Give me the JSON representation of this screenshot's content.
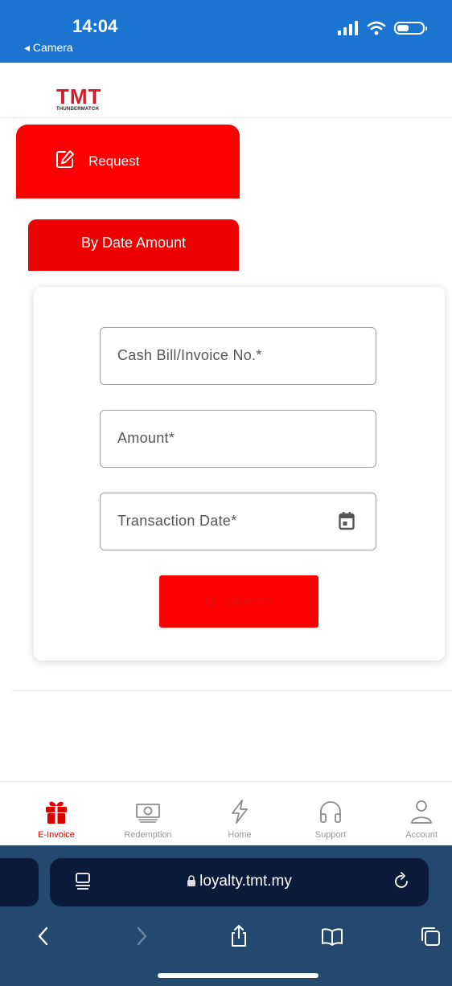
{
  "status_bar": {
    "time": "14:04",
    "back_label": "◂ Camera"
  },
  "header": {
    "logo_text": "TMT",
    "logo_subtext": "THUNDERMATCH"
  },
  "tabs": {
    "request_label": "Request",
    "mode_label": "By Date Amount"
  },
  "form": {
    "invoice_placeholder": "Cash Bill/Invoice No.*",
    "amount_placeholder": "Amount*",
    "date_placeholder": "Transaction Date*",
    "search_label": "Search"
  },
  "bottom_nav": {
    "items": [
      {
        "label": "E-Invoice",
        "icon": "gift-icon",
        "active": true
      },
      {
        "label": "Redemption",
        "icon": "banknote-icon",
        "active": false
      },
      {
        "label": "Home",
        "icon": "lightning-icon",
        "active": false
      },
      {
        "label": "Support",
        "icon": "headset-icon",
        "active": false
      },
      {
        "label": "Account",
        "icon": "user-icon",
        "active": false
      }
    ]
  },
  "browser": {
    "url": "loyalty.tmt.my"
  },
  "colors": {
    "status_bar": "#1b74d0",
    "accent_red": "#ff0000",
    "browser_bar": "#23496f",
    "url_bar": "#0a1a3b"
  }
}
